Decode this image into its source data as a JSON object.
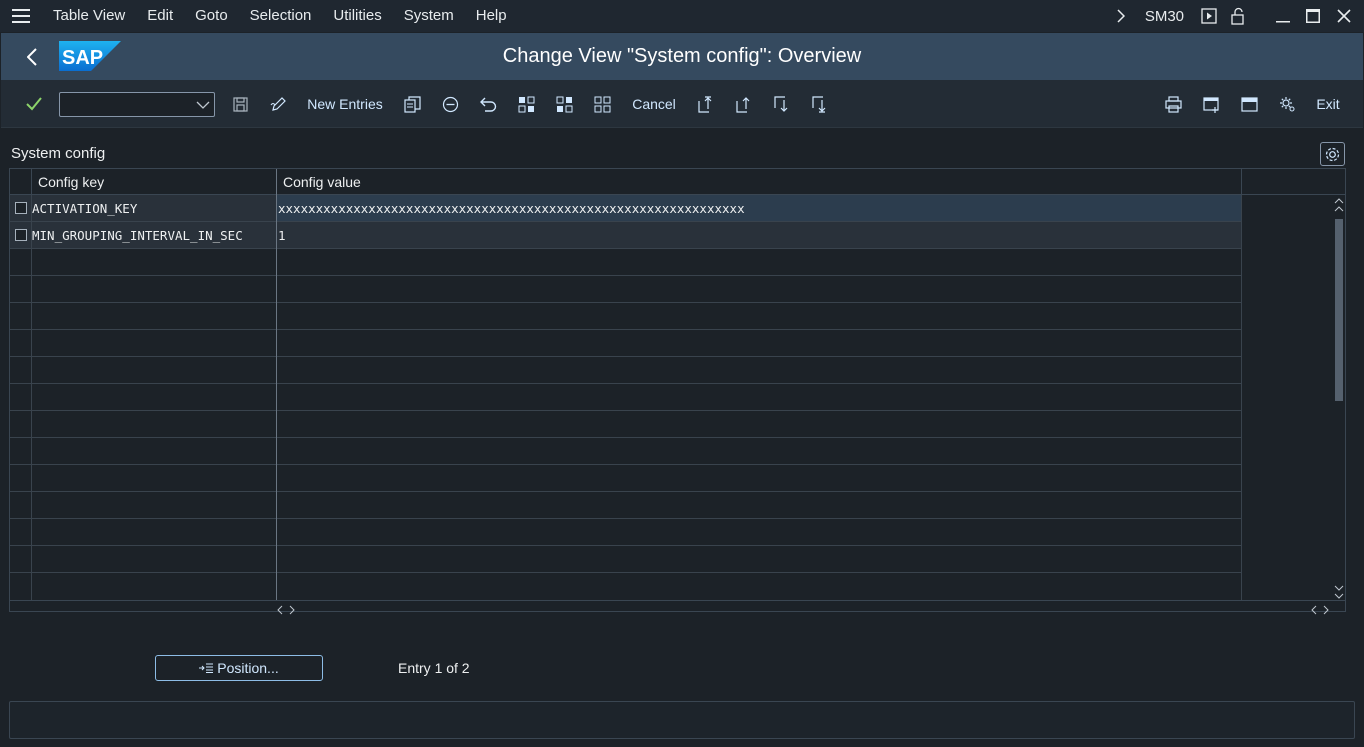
{
  "menu": {
    "items": [
      "Table View",
      "Edit",
      "Goto",
      "Selection",
      "Utilities",
      "System",
      "Help"
    ],
    "transaction_code": "SM30"
  },
  "title": "Change View \"System config\": Overview",
  "toolbar": {
    "new_entries": "New Entries",
    "cancel": "Cancel",
    "exit": "Exit",
    "okcode_value": ""
  },
  "table": {
    "section_title": "System config",
    "columns": [
      "Config key",
      "Config value"
    ],
    "rows": [
      {
        "key": "ACTIVATION_KEY",
        "value": "xxxxxxxxxxxxxxxxxxxxxxxxxxxxxxxxxxxxxxxxxxxxxxxxxxxxxxxxxxxxxx"
      },
      {
        "key": "MIN_GROUPING_INTERVAL_IN_SEC",
        "value": "1"
      }
    ],
    "empty_rows": 13
  },
  "position_button": "Position...",
  "entry_info": "Entry 1 of 2",
  "colors": {
    "accent": "#d1e8ff",
    "header_bg": "#354a5f",
    "background": "#1c2228"
  }
}
